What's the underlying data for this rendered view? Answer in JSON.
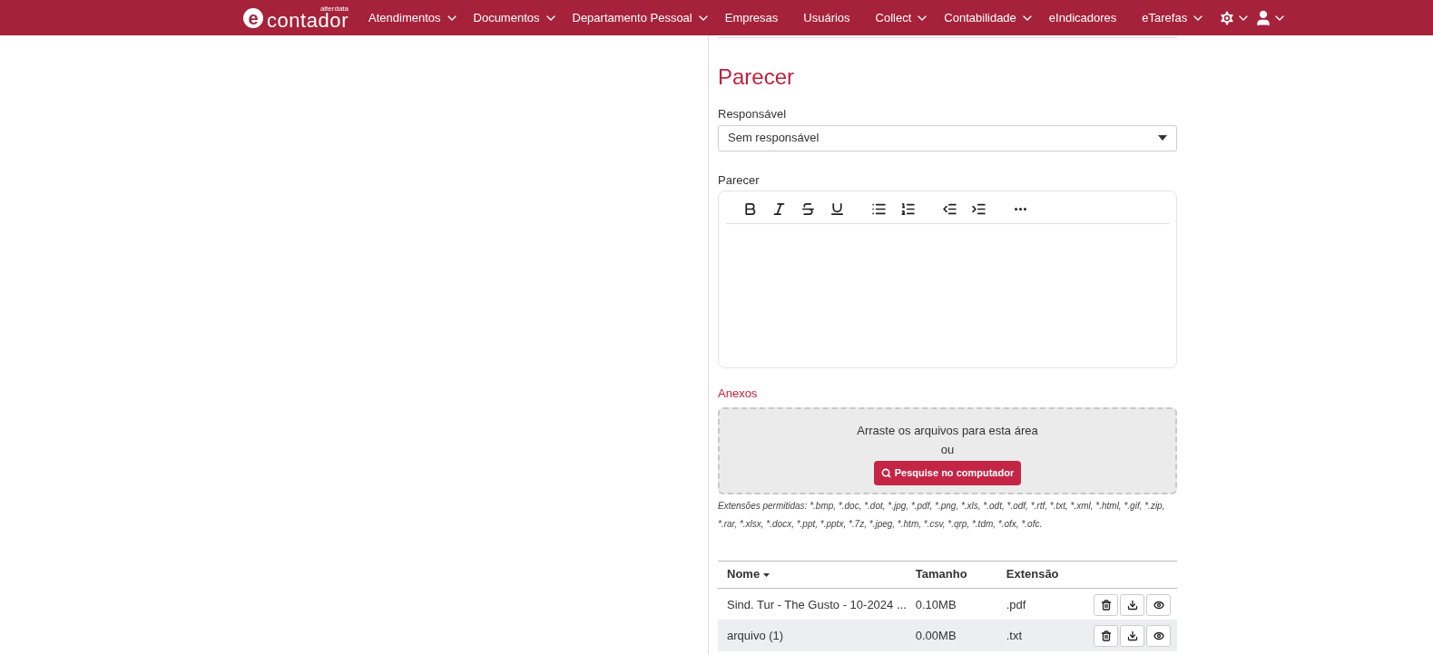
{
  "navbar": {
    "logo": {
      "mark": "e",
      "name": "contador",
      "sub": "alterdata"
    },
    "items": [
      {
        "label": "Atendimentos",
        "dropdown": true
      },
      {
        "label": "Documentos",
        "dropdown": true
      },
      {
        "label": "Departamento Pessoal",
        "dropdown": true
      },
      {
        "label": "Empresas",
        "dropdown": false
      },
      {
        "label": "Usuários",
        "dropdown": false
      },
      {
        "label": "Collect",
        "dropdown": true
      },
      {
        "label": "Contabilidade",
        "dropdown": true
      },
      {
        "label": "eIndicadores",
        "dropdown": false
      },
      {
        "label": "eTarefas",
        "dropdown": true
      }
    ]
  },
  "form": {
    "title": "Parecer",
    "responsavel": {
      "label": "Responsável",
      "value": "Sem responsável"
    },
    "parecer": {
      "label": "Parecer"
    },
    "anexos": {
      "label": "Anexos",
      "drop_text": "Arraste os arquivos para esta área",
      "or": "ou",
      "button": "Pesquise no computador",
      "extensions": "Extensões permitidas: *.bmp, *.doc, *.dot, *.jpg, *.pdf, *.png, *.xls, *.odt, *.odf, *.rtf, *.txt, *.xml, *.html, *.gif, *.zip, *.rar, *.xlsx, *.docx, *.ppt, *.pptx, *.7z, *.jpeg, *.htm, *.csv, *.qrp, *.tdm, *.ofx, *.ofc."
    }
  },
  "table": {
    "columns": [
      "Nome",
      "Tamanho",
      "Extensão"
    ],
    "rows": [
      {
        "name": "Sind. Tur - The Gusto - 10-2024 ...",
        "size": "0.10MB",
        "ext": ".pdf"
      },
      {
        "name": "arquivo (1)",
        "size": "0.00MB",
        "ext": ".txt"
      }
    ]
  }
}
